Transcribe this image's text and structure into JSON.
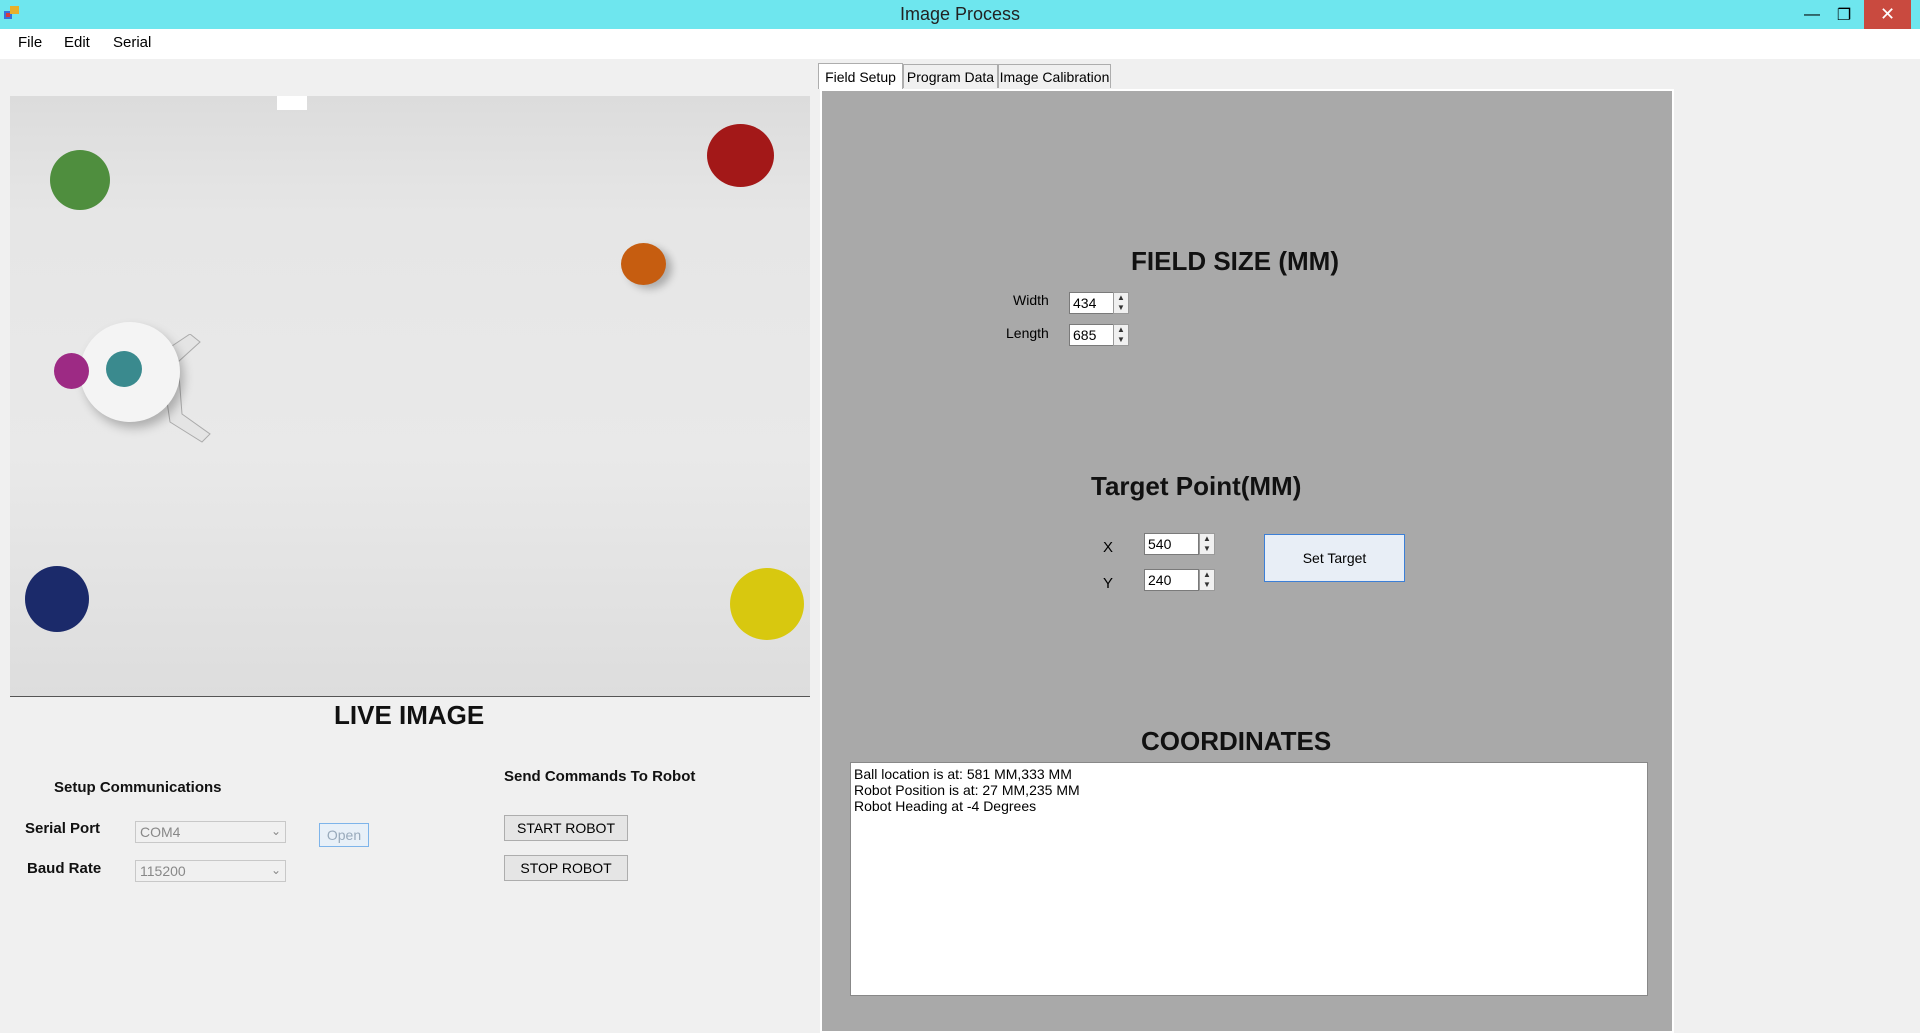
{
  "window": {
    "title": "Image Process",
    "minimize": "—",
    "maximize": "❐",
    "close": "✕"
  },
  "menu": {
    "file": "File",
    "edit": "Edit",
    "serial": "Serial"
  },
  "live": {
    "label": "LIVE IMAGE"
  },
  "comms": {
    "heading": "Setup Communications",
    "serial_port_label": "Serial Port",
    "serial_port_value": "COM4",
    "baud_rate_label": "Baud Rate",
    "baud_rate_value": "115200",
    "open_button": "Open"
  },
  "commands": {
    "heading": "Send Commands To Robot",
    "start": "START ROBOT",
    "stop": "STOP ROBOT"
  },
  "tabs": {
    "field_setup": "Field Setup",
    "program_data": "Program Data",
    "image_calibration": "Image Calibration"
  },
  "field": {
    "heading": "FIELD SIZE (MM)",
    "width_label": "Width",
    "width_value": "434",
    "length_label": "Length",
    "length_value": "685"
  },
  "target": {
    "heading": "Target Point(MM)",
    "x_label": "X",
    "x_value": "540",
    "y_label": "Y",
    "y_value": "240",
    "set_button": "Set Target"
  },
  "coordinates": {
    "heading": "COORDINATES",
    "line1": "Ball location is at: 581 MM,333 MM",
    "line2": "Robot Position is at: 27 MM,235 MM",
    "line3": "Robot Heading at -4 Degrees"
  },
  "colors": {
    "titlebar": "#6ee6ee",
    "panel": "#a9a9a9",
    "close": "#c94a3f"
  }
}
